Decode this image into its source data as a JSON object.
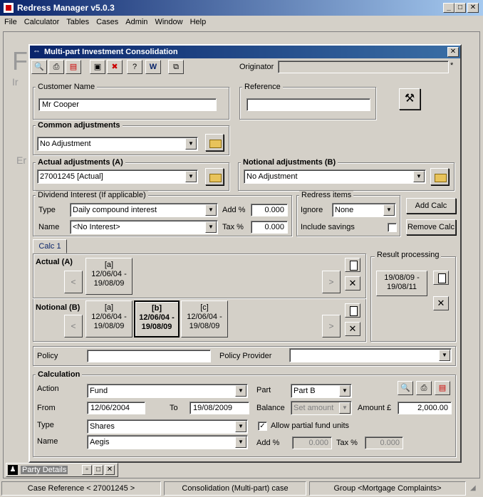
{
  "app": {
    "title": "Redress Manager v5.0.3"
  },
  "window_controls": {
    "minimize": "_",
    "maximize": "□",
    "close": "✕"
  },
  "menu": [
    "File",
    "Calculator",
    "Tables",
    "Cases",
    "Admin",
    "Window",
    "Help"
  ],
  "background": {
    "letter1": "F",
    "letter2": "Ir",
    "letter3": "Er"
  },
  "child": {
    "title": "Multi-part Investment Consolidation",
    "close": "✕",
    "originator_label": "Originator",
    "originator_value": "",
    "asterisk": "*"
  },
  "customer": {
    "label": "Customer Name",
    "value": "Mr Cooper"
  },
  "reference": {
    "label": "Reference",
    "value": ""
  },
  "common_adjustments": {
    "label": "Common adjustments",
    "value": "No Adjustment"
  },
  "actual_adjustments": {
    "label": "Actual adjustments (A)",
    "value": "27001245 [Actual]"
  },
  "notional_adjustments": {
    "label": "Notional adjustments (B)",
    "value": "No Adjustment"
  },
  "dividend": {
    "label": "Dividend Interest (If applicable)",
    "type_label": "Type",
    "type_value": "Daily compound interest",
    "name_label": "Name",
    "name_value": "<No Interest>",
    "add_label": "Add %",
    "add_value": "0.000",
    "tax_label": "Tax %",
    "tax_value": "0.000"
  },
  "redress": {
    "label": "Redress items",
    "ignore_label": "Ignore",
    "ignore_value": "None",
    "savings_label": "Include savings"
  },
  "buttons": {
    "add_calc": "Add Calc",
    "remove_calc": "Remove Calc"
  },
  "tabs": [
    {
      "label": "Calc 1"
    }
  ],
  "actual_row": {
    "label": "Actual (A)",
    "segments": [
      {
        "line1": "[a]",
        "line2": "12/06/04 -",
        "line3": "19/08/09"
      }
    ]
  },
  "notional_row": {
    "label": "Notional (B)",
    "segments": [
      {
        "line1": "[a]",
        "line2": "12/06/04 -",
        "line3": "19/08/09"
      },
      {
        "line1": "[b]",
        "line2": "12/06/04 -",
        "line3": "19/08/09"
      },
      {
        "line1": "[c]",
        "line2": "12/06/04 -",
        "line3": "19/08/09"
      }
    ]
  },
  "nav": {
    "prev": "<",
    "next": ">"
  },
  "result": {
    "label": "Result processing",
    "line1": "19/08/09 -",
    "line2": "19/08/11"
  },
  "policy": {
    "label": "Policy",
    "value": "",
    "provider_label": "Policy Provider",
    "provider_value": ""
  },
  "calculation": {
    "label": "Calculation",
    "action_label": "Action",
    "action_value": "Fund",
    "from_label": "From",
    "from_value": "12/06/2004",
    "to_label": "To",
    "to_value": "19/08/2009",
    "type_label": "Type",
    "type_value": "Shares",
    "name_label": "Name",
    "name_value": "Aegis",
    "part_label": "Part",
    "part_value": "Part B",
    "balance_label": "Balance",
    "balance_value": "Set amount",
    "amount_label": "Amount £",
    "amount_value": "2,000.00",
    "partial_label": "Allow partial fund units",
    "add_label": "Add %",
    "add_value": "0.000",
    "tax_label": "Tax %",
    "tax_value": "0.000"
  },
  "taskbar": {
    "item": "Party Details"
  },
  "status": {
    "case_ref": "Case Reference < 27001245 >",
    "case_type": "Consolidation (Multi-part) case",
    "group": "Group <Mortgage Complaints>"
  },
  "colors": {
    "title_start": "#0a246a",
    "title_end": "#a6caf0",
    "face": "#d4d0c8",
    "folder": "#e8c35a"
  }
}
